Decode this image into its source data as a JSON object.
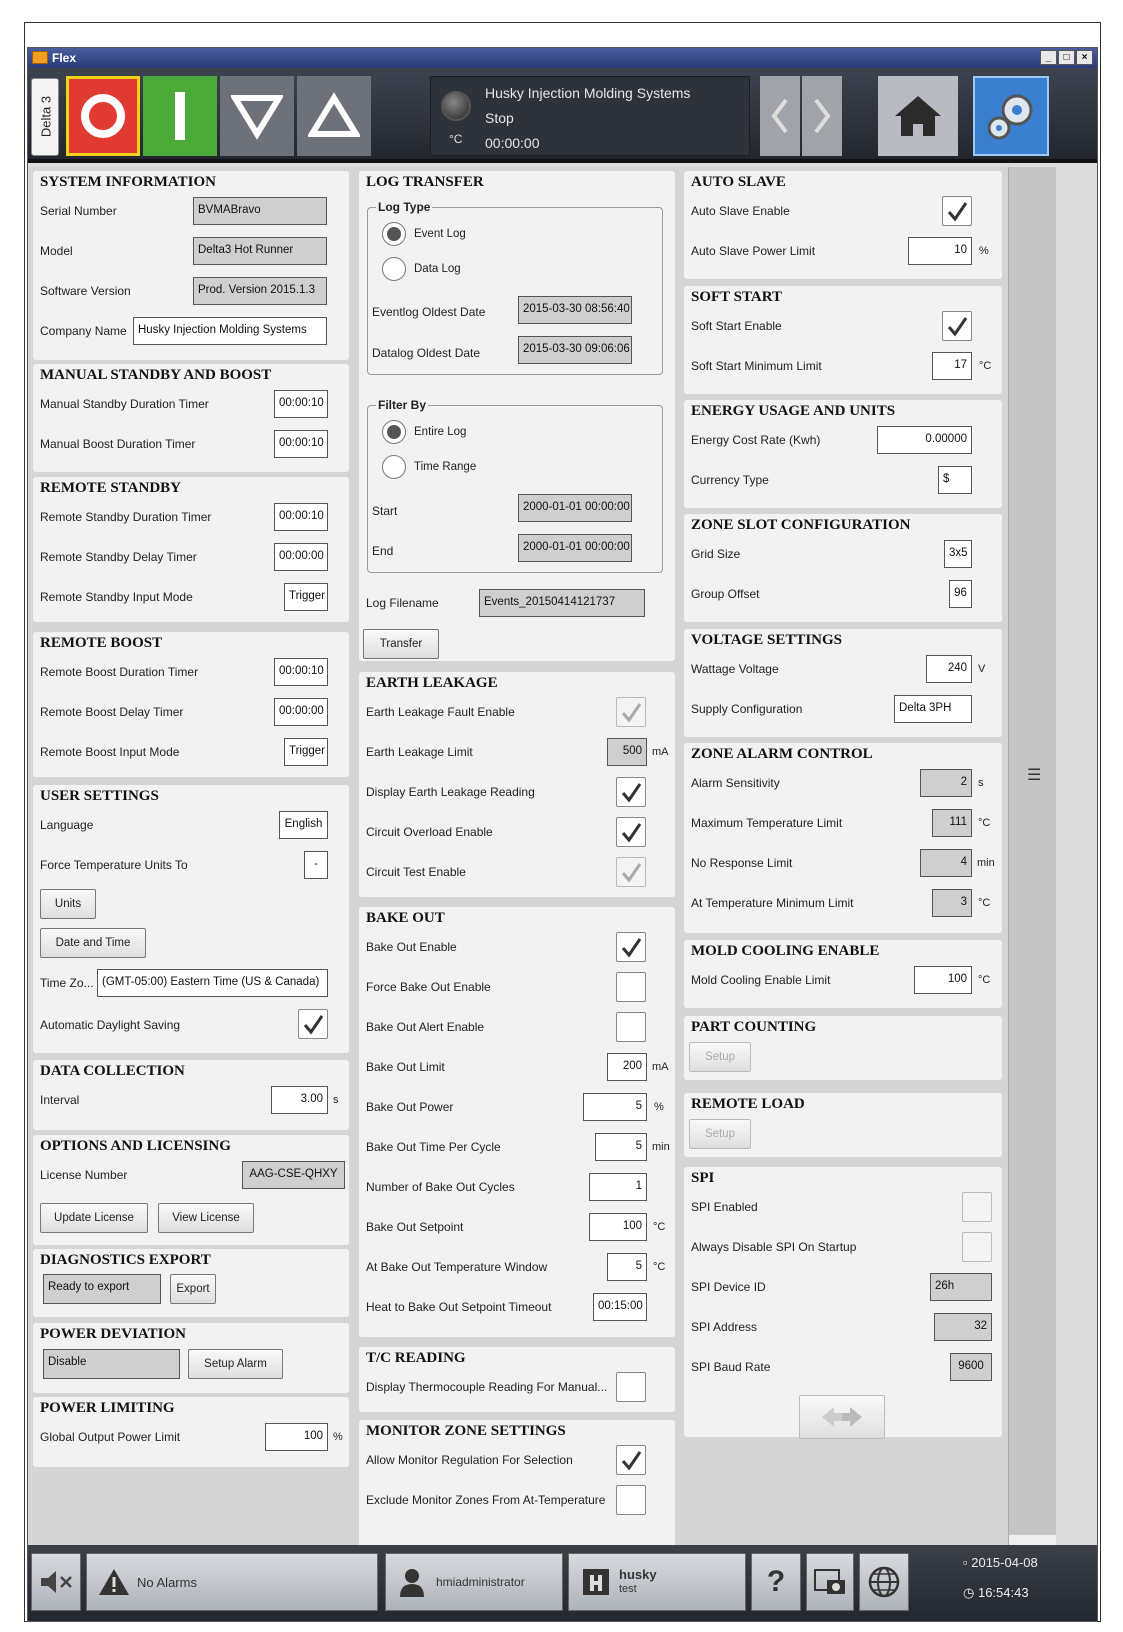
{
  "window": {
    "title": "Flex",
    "min": "_",
    "max": "□",
    "close": "×"
  },
  "topbar": {
    "machine_tab": "Delta 3",
    "status_line1": "Husky Injection Molding Systems",
    "status_line2": "Stop",
    "status_line3": "00:00:00",
    "temp_unit": "°C"
  },
  "system_information": {
    "title": "SYSTEM INFORMATION",
    "serial_label": "Serial Number",
    "serial": "BVMABravo",
    "model_label": "Model",
    "model": "Delta3 Hot Runner",
    "software_label": "Software Version",
    "software": "Prod. Version 2015.1.3",
    "company_label": "Company Name",
    "company": "Husky Injection Molding Systems"
  },
  "manual_standby": {
    "title": "MANUAL STANDBY AND BOOST",
    "standby_label": "Manual Standby Duration Timer",
    "standby": "00:00:10",
    "boost_label": "Manual Boost Duration Timer",
    "boost": "00:00:10"
  },
  "remote_standby": {
    "title": "REMOTE STANDBY",
    "duration_label": "Remote Standby Duration Timer",
    "duration": "00:00:10",
    "delay_label": "Remote Standby Delay Timer",
    "delay": "00:00:00",
    "input_label": "Remote Standby Input Mode",
    "input": "Trigger"
  },
  "remote_boost": {
    "title": "REMOTE BOOST",
    "duration_label": "Remote Boost Duration Timer",
    "duration": "00:00:10",
    "delay_label": "Remote Boost Delay Timer",
    "delay": "00:00:00",
    "input_label": "Remote Boost Input Mode",
    "input": "Trigger"
  },
  "user_settings": {
    "title": "USER SETTINGS",
    "language_label": "Language",
    "language": "English",
    "force_label": "Force Temperature Units To",
    "force": "-",
    "units_btn": "Units",
    "datetime_btn": "Date and Time",
    "tz_label": "Time Zo...",
    "tz": "(GMT-05:00) Eastern Time (US & Canada)",
    "dst_label": "Automatic Daylight Saving"
  },
  "data_collection": {
    "title": "DATA COLLECTION",
    "interval_label": "Interval",
    "interval": "3.00",
    "unit": "s"
  },
  "options": {
    "title": "OPTIONS AND LICENSING",
    "license_label": "License Number",
    "license": "AAG-CSE-QHXY",
    "update_btn": "Update License",
    "view_btn": "View License"
  },
  "diagnostics": {
    "title": "DIAGNOSTICS EXPORT",
    "status": "Ready to export",
    "export_btn": "Export"
  },
  "power_deviation": {
    "title": "POWER DEVIATION",
    "value": "Disable",
    "alarm_btn": "Setup Alarm"
  },
  "power_limiting": {
    "title": "POWER LIMITING",
    "limit_label": "Global Output Power Limit",
    "limit": "100",
    "unit": "%"
  },
  "log_transfer": {
    "title": "LOG TRANSFER",
    "log_type": "Log Type",
    "event_log": "Event Log",
    "data_log": "Data Log",
    "eventlog_label": "Eventlog Oldest Date",
    "eventlog": "2015-03-30 08:56:40",
    "datalog_label": "Datalog Oldest Date",
    "datalog": "2015-03-30 09:06:06",
    "filter_by": "Filter By",
    "entire_log": "Entire Log",
    "time_range": "Time Range",
    "start_label": "Start",
    "start": "2000-01-01 00:00:00",
    "end_label": "End",
    "end": "2000-01-01 00:00:00",
    "filename_label": "Log Filename",
    "filename": "Events_20150414121737",
    "transfer_btn": "Transfer"
  },
  "earth_leakage": {
    "title": "EARTH LEAKAGE",
    "fault_label": "Earth Leakage Fault Enable",
    "limit_label": "Earth Leakage Limit",
    "limit": "500",
    "limit_unit": "mA",
    "display_label": "Display Earth Leakage Reading",
    "overload_label": "Circuit Overload Enable",
    "test_label": "Circuit Test Enable"
  },
  "bake_out": {
    "title": "BAKE OUT",
    "enable_label": "Bake Out Enable",
    "force_label": "Force Bake Out Enable",
    "alert_label": "Bake Out Alert Enable",
    "limit_label": "Bake Out Limit",
    "limit": "200",
    "limit_unit": "mA",
    "power_label": "Bake Out Power",
    "power": "5",
    "power_unit": "%",
    "time_label": "Bake Out Time Per Cycle",
    "time": "5",
    "time_unit": "min",
    "cycles_label": "Number of Bake Out Cycles",
    "cycles": "1",
    "setpoint_label": "Bake Out Setpoint",
    "setpoint": "100",
    "setpoint_unit": "°C",
    "window_label": "At Bake Out Temperature Window",
    "window": "5",
    "window_unit": "°C",
    "timeout_label": "Heat to Bake Out Setpoint Timeout",
    "timeout": "00:15:00"
  },
  "tc_reading": {
    "title": "T/C READING",
    "display_label": "Display Thermocouple Reading For Manual..."
  },
  "monitor_zone": {
    "title": "MONITOR ZONE SETTINGS",
    "allow_label": "Allow Monitor Regulation For Selection",
    "exclude_label": "Exclude Monitor Zones From At-Temperature"
  },
  "auto_slave": {
    "title": "AUTO SLAVE",
    "enable_label": "Auto Slave Enable",
    "limit_label": "Auto Slave Power Limit",
    "limit": "10",
    "unit": "%"
  },
  "soft_start": {
    "title": "SOFT START",
    "enable_label": "Soft Start Enable",
    "min_label": "Soft Start Minimum Limit",
    "min": "17",
    "unit": "°C"
  },
  "energy": {
    "title": "ENERGY USAGE AND UNITS",
    "rate_label": "Energy Cost Rate (Kwh)",
    "rate": "0.00000",
    "currency_label": "Currency Type",
    "currency": "$"
  },
  "zone_slot": {
    "title": "ZONE SLOT CONFIGURATION",
    "grid_label": "Grid Size",
    "grid": "3x5",
    "offset_label": "Group Offset",
    "offset": "96"
  },
  "voltage": {
    "title": "VOLTAGE SETTINGS",
    "wattage_label": "Wattage Voltage",
    "wattage": "240",
    "wattage_unit": "V",
    "supply_label": "Supply Configuration",
    "supply": "Delta 3PH"
  },
  "zone_alarm": {
    "title": "ZONE ALARM CONTROL",
    "sens_label": "Alarm Sensitivity",
    "sens": "2",
    "sens_unit": "s",
    "max_label": "Maximum Temperature Limit",
    "max": "111",
    "max_unit": "°C",
    "noresp_label": "No Response Limit",
    "noresp": "4",
    "noresp_unit": "min",
    "attemp_label": "At Temperature Minimum Limit",
    "attemp": "3",
    "attemp_unit": "°C"
  },
  "mold_cooling": {
    "title": "MOLD COOLING ENABLE",
    "limit_label": "Mold Cooling Enable Limit",
    "limit": "100",
    "unit": "°C"
  },
  "part_counting": {
    "title": "PART COUNTING",
    "setup_btn": "Setup"
  },
  "remote_load": {
    "title": "REMOTE LOAD",
    "setup_btn": "Setup"
  },
  "spi": {
    "title": "SPI",
    "enabled_label": "SPI Enabled",
    "disable_label": "Always Disable SPI On Startup",
    "device_label": "SPI Device ID",
    "device": "26h",
    "address_label": "SPI Address",
    "address": "32",
    "baud_label": "SPI Baud Rate",
    "baud": "9600"
  },
  "bottombar": {
    "alarms": "No Alarms",
    "user": "hmiadministrator",
    "brand": "husky",
    "brand_sub": "test",
    "date": "2015-04-08",
    "time": "16:54:43",
    "help": "?"
  }
}
